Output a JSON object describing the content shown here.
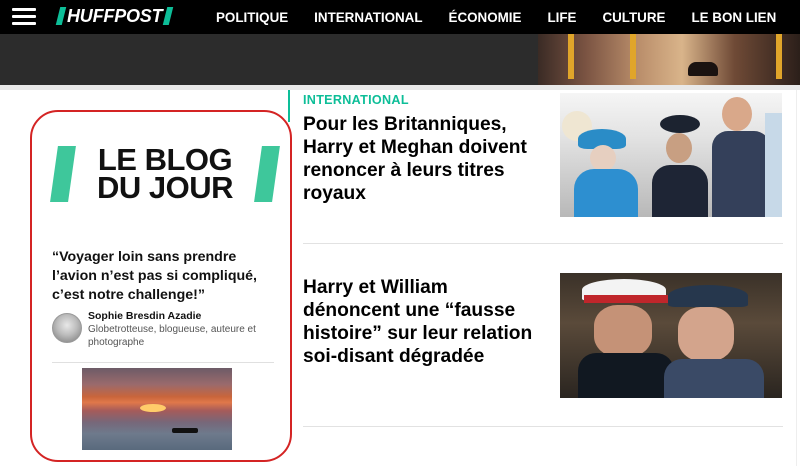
{
  "brand": {
    "logo": "HUFFPOST",
    "accent": "#0dbe98"
  },
  "nav": {
    "menu_icon": "hamburger-menu-icon",
    "items": [
      "POLITIQUE",
      "INTERNATIONAL",
      "ÉCONOMIE",
      "LIFE",
      "CULTURE",
      "LE BON LIEN"
    ]
  },
  "blog": {
    "banner_line1": "LE BLOG",
    "banner_line2": "DU JOUR",
    "quote": "“Voyager loin sans prendre l’avion n’est pas si compliqué, c’est notre challenge!”",
    "author_name": "Sophie Bresdin Azadie",
    "author_bio": "Globetrotteuse, blogueuse, auteure et photographe",
    "highlight_color": "#d42424"
  },
  "articles": [
    {
      "kicker": "INTERNATIONAL",
      "title": "Pour les Britanniques, Harry et Meghan doivent renoncer à leurs titres royaux"
    },
    {
      "kicker": "",
      "title": "Harry et William dénoncent une “fausse histoire” sur leur relation soi-disant dégradée"
    }
  ]
}
